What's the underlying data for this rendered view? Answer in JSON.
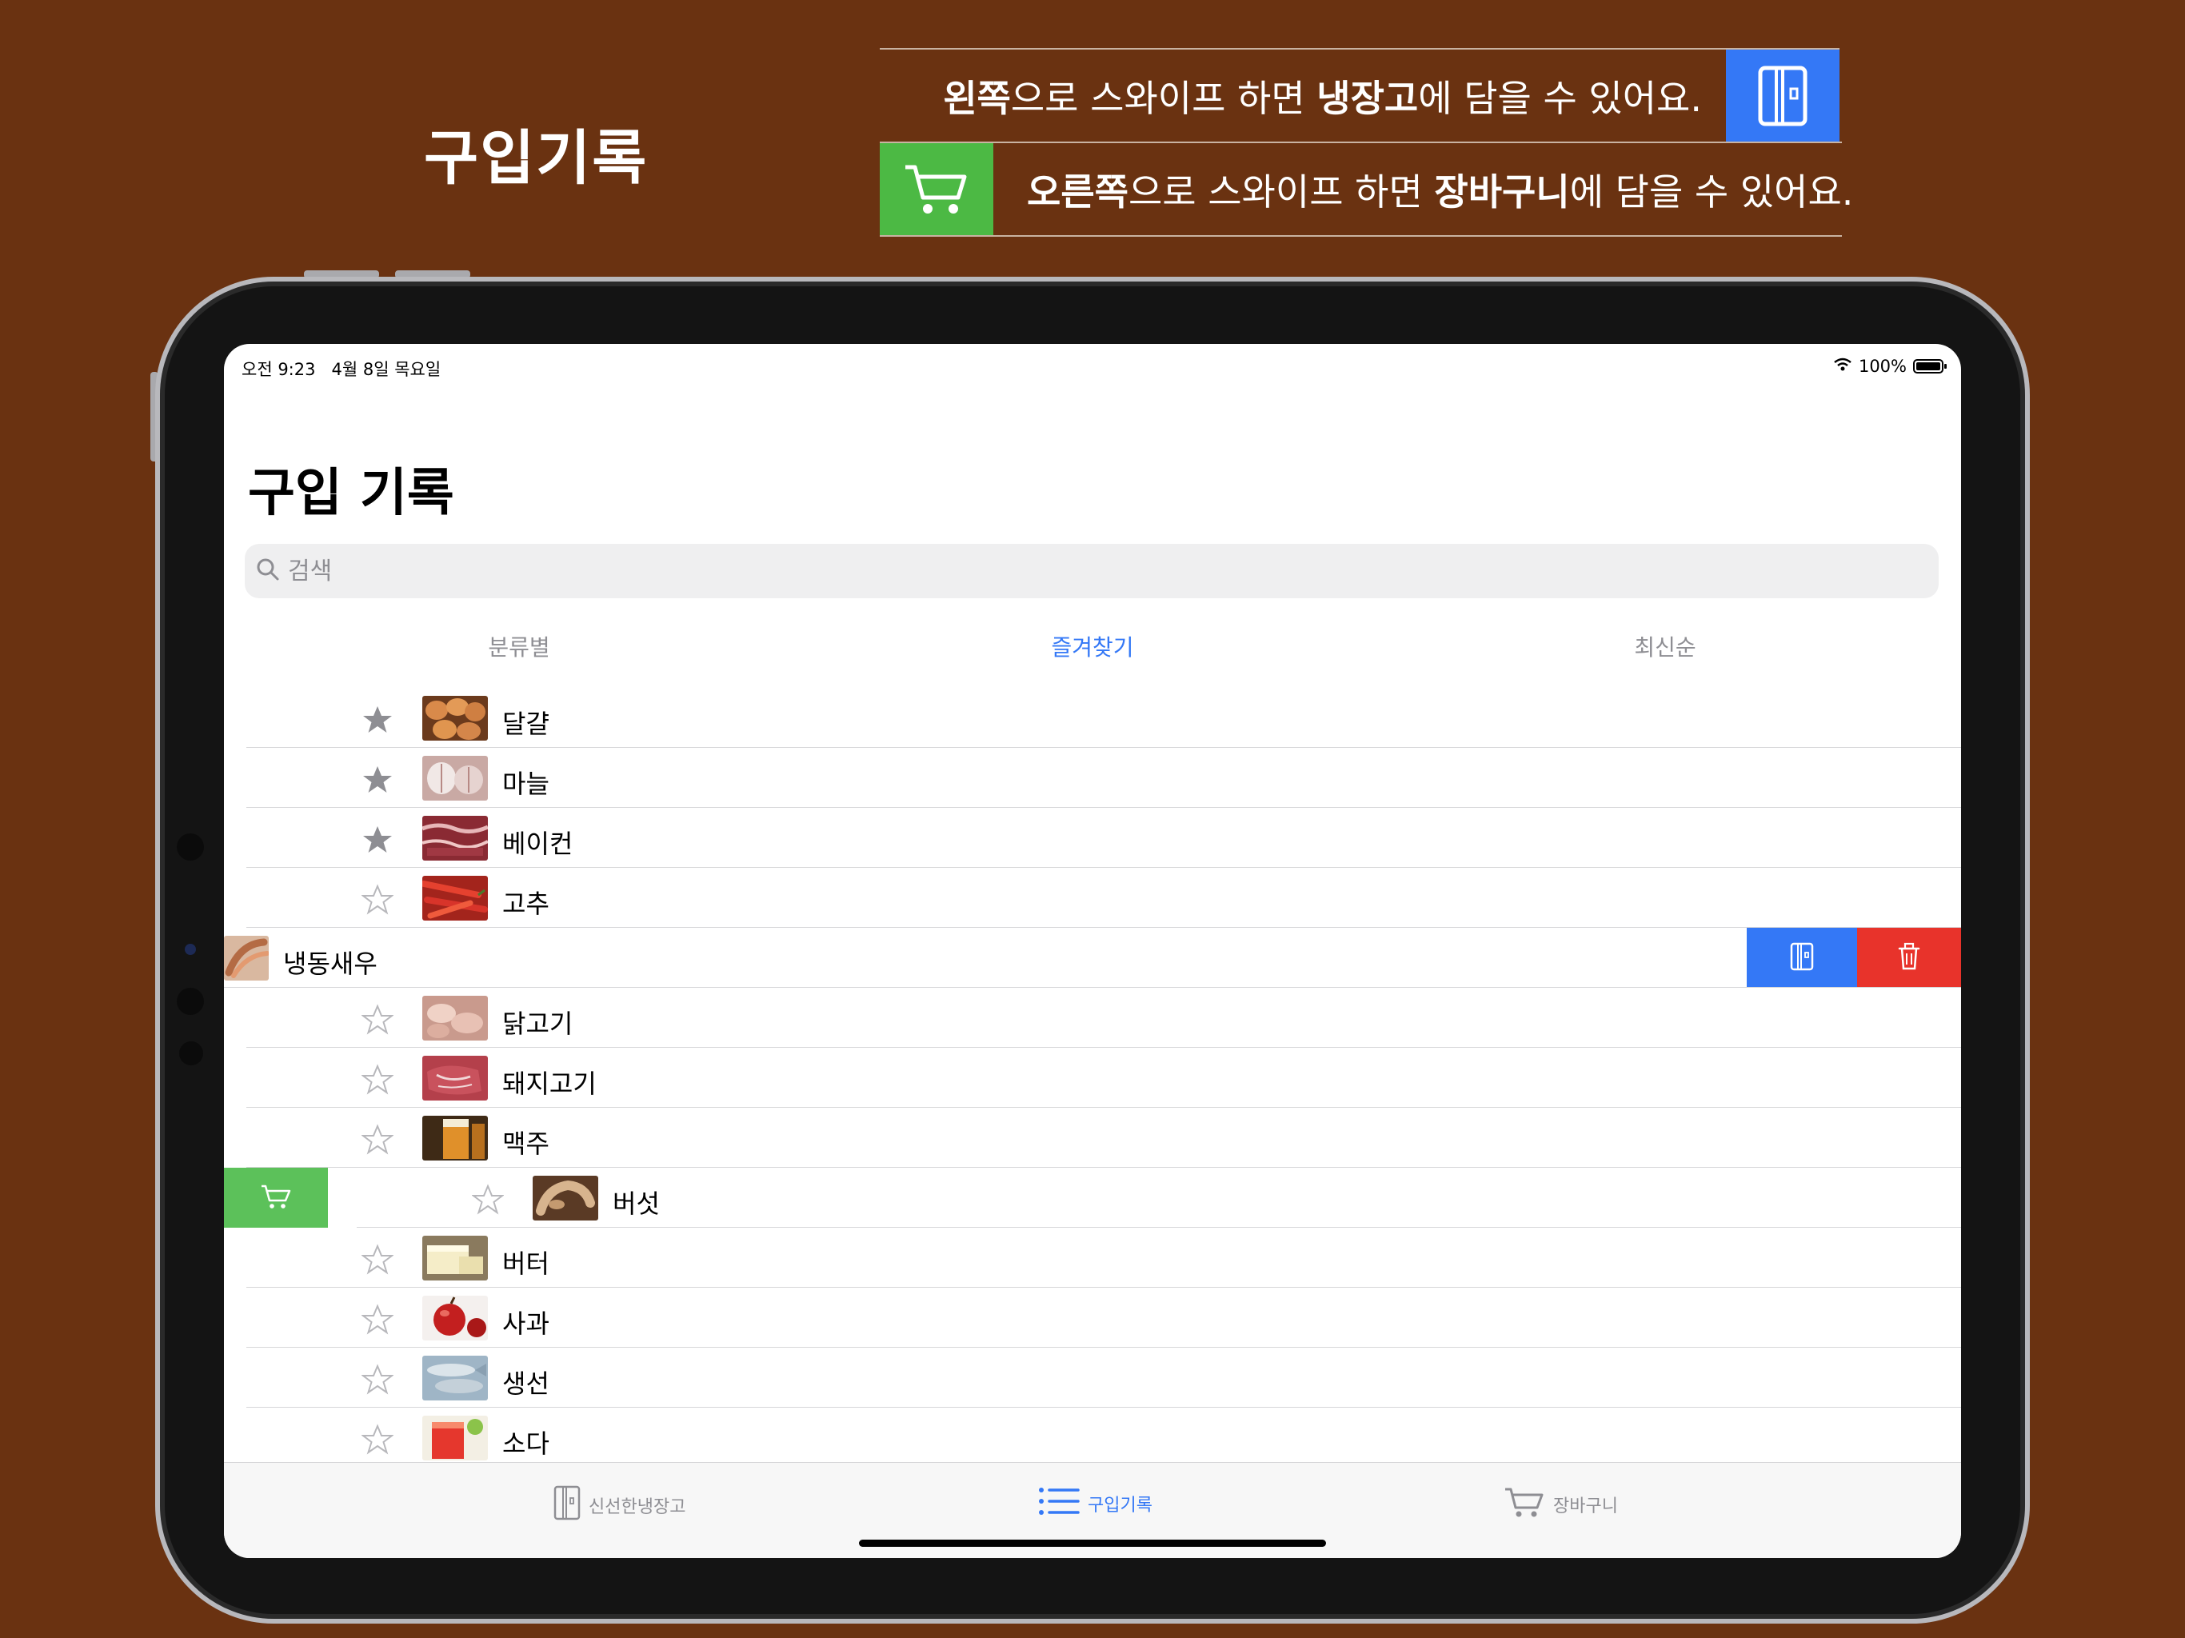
{
  "banner": {
    "title": "구입기록",
    "hint_left": {
      "b1": "왼쪽",
      "t1": "으로 스와이프 하면 ",
      "b2": "냉장고",
      "t2": "에 담을 수 있어요."
    },
    "hint_right": {
      "b1": "오른쪽",
      "t1": "으로 스와이프 하면 ",
      "b2": "장바구니",
      "t2": "에 담을 수 있어요."
    }
  },
  "status": {
    "time": "오전 9:23",
    "date": "4월 8일 목요일",
    "battery": "100%"
  },
  "page_title": "구입 기록",
  "search": {
    "placeholder": "검색"
  },
  "segments": {
    "category": "분류별",
    "favorites": "즐겨찾기",
    "recent": "최신순",
    "selected": "즐겨찾기"
  },
  "items": [
    {
      "name": "달걀",
      "favorite": true,
      "photo": "eggs"
    },
    {
      "name": "마늘",
      "favorite": true,
      "photo": "garlic"
    },
    {
      "name": "베이컨",
      "favorite": true,
      "photo": "bacon"
    },
    {
      "name": "고추",
      "favorite": false,
      "photo": "pepper"
    },
    {
      "name": "냉동새우",
      "favorite": false,
      "photo": "shrimp",
      "swipe": "left"
    },
    {
      "name": "닭고기",
      "favorite": false,
      "photo": "chicken"
    },
    {
      "name": "돼지고기",
      "favorite": false,
      "photo": "pork"
    },
    {
      "name": "맥주",
      "favorite": false,
      "photo": "beer"
    },
    {
      "name": "버섯",
      "favorite": false,
      "photo": "mushroom",
      "swipe": "right"
    },
    {
      "name": "버터",
      "favorite": false,
      "photo": "butter"
    },
    {
      "name": "사과",
      "favorite": false,
      "photo": "apple"
    },
    {
      "name": "생선",
      "favorite": false,
      "photo": "fish"
    },
    {
      "name": "소다",
      "favorite": false,
      "photo": "soda"
    }
  ],
  "row_actions": {
    "fridge_icon": "fridge-icon",
    "trash_icon": "trash-icon",
    "cart_icon": "cart-icon"
  },
  "tabbar": {
    "fridge": "신선한냉장고",
    "history": "구입기록",
    "cart": "장바구니",
    "selected": "구입기록"
  },
  "colors": {
    "background": "#6a3211",
    "accent": "#3478f6",
    "delete": "#e8332b",
    "cart": "#5cc15a",
    "star": "#8e8e93"
  }
}
